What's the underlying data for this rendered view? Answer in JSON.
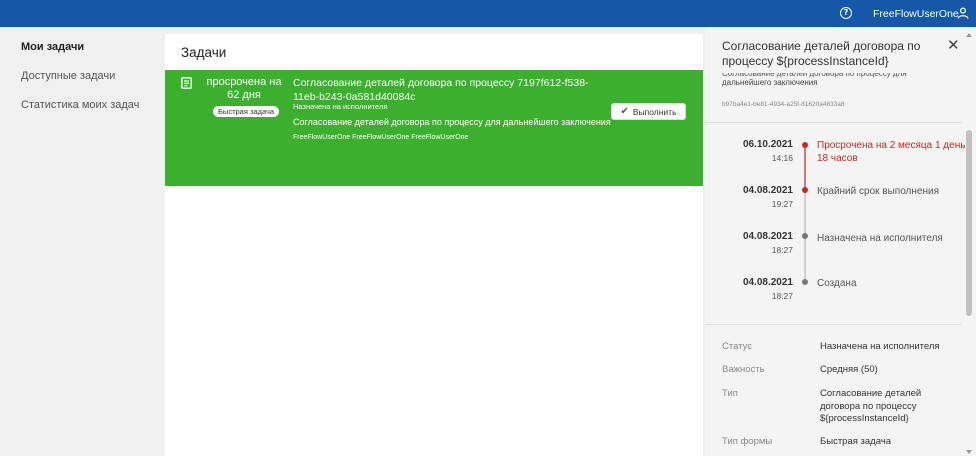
{
  "header": {
    "help_icon": "help-circle-icon",
    "username": "FreeFlowUserOne",
    "user_icon": "user-icon",
    "bar_color": "#1558a8"
  },
  "sidebar": {
    "items": [
      {
        "label": "Мои задачи",
        "active": true
      },
      {
        "label": "Доступные задачи"
      },
      {
        "label": "Статистика моих задач"
      }
    ]
  },
  "main": {
    "title": "Задачи",
    "task": {
      "overdue": "просрочена на 62 дня",
      "badge": "Быстрая задача",
      "title": "Согласование деталей договора по процессу 7197f612-f538-11eb-b243-0a581d40084c",
      "status": "Назначена на исполнителя",
      "description": "Согласование деталей договора по процессу для дальнейшего заключения",
      "users": "FreeFlowUserOne FreeFlowUserOne FreeFlowUserOne",
      "action_label": "Выполнить",
      "color": "#3cb02e"
    }
  },
  "details": {
    "title": "Согласование деталей договора по процессу ${processInstanceId}",
    "clipped_line": "Согласование деталей договора по процессу для",
    "clipped_line2": "дальнейшего заключения",
    "process_id": "b97ba4e1-be81-4934-a25f-81620a4833a8",
    "timeline": [
      {
        "date": "06.10.2021",
        "time": "14:16",
        "text": "Просрочена на 2 месяца 1 день 18 часов",
        "overdue": true
      },
      {
        "date": "04.08.2021",
        "time": "19:27",
        "text": "Крайний срок выполнения",
        "overdue": true
      },
      {
        "date": "04.08.2021",
        "time": "18:27",
        "text": "Назначена на исполнителя"
      },
      {
        "date": "04.08.2021",
        "time": "18:27",
        "text": "Создана"
      }
    ],
    "props": [
      {
        "label": "Статус",
        "value": "Назначена на исполнителя"
      },
      {
        "label": "Важность",
        "value": "Средняя (50)"
      },
      {
        "label": "Тип",
        "value": "Согласование деталей договора по процессу ${processInstanceId}"
      },
      {
        "label": "Тип формы",
        "value": "Быстрая задача"
      }
    ],
    "overdue_color": "#c62828"
  }
}
